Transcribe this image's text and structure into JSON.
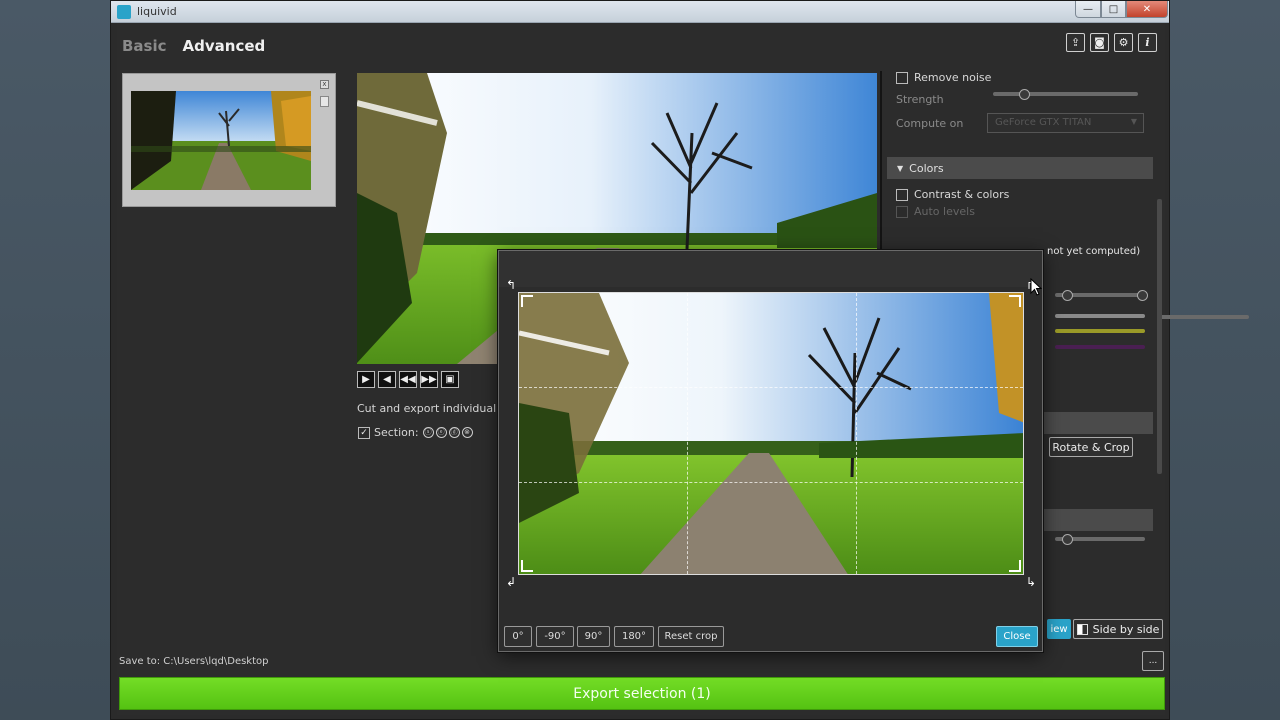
{
  "window": {
    "title": "liquivid",
    "min_glyph": "—",
    "max_glyph": "□",
    "close_glyph": "✕"
  },
  "mode_tabs": {
    "basic": "Basic",
    "advanced": "Advanced"
  },
  "top_icons": [
    {
      "name": "share-icon",
      "glyph": "⇪"
    },
    {
      "name": "camera-icon",
      "glyph": "◙"
    },
    {
      "name": "gear-icon",
      "glyph": "⚙"
    },
    {
      "name": "info-icon",
      "glyph": "i"
    }
  ],
  "thumbnail": {
    "close_glyph": "x"
  },
  "transport": [
    "▶",
    "◀",
    "◀◀",
    "▶▶",
    "▣"
  ],
  "cut_export_text": "Cut and export individual sections",
  "section": {
    "label": "Section:",
    "icons": [
      "ⓢ",
      "ⓔ",
      "ⓓ",
      "⊗"
    ],
    "checked": true
  },
  "right_panel": {
    "remove_noise": "Remove noise",
    "strength": "Strength",
    "compute_on": "Compute on",
    "compute_device": "GeForce GTX TITAN",
    "colors_header": "Colors",
    "contrast_colors": "Contrast & colors",
    "auto_levels": "Auto levels",
    "not_computed": "not yet computed)",
    "rotate_crop": "Rotate & Crop",
    "view_tab": "iew",
    "side_by_side": "Side by side"
  },
  "save_to": "Save to: C:\\Users\\lqd\\Desktop",
  "browse_label": "...",
  "export_label": "Export selection (1)",
  "crop_dialog": {
    "buttons": [
      "0°",
      "-90°",
      "90°",
      "180°",
      "Reset crop"
    ],
    "close": "Close"
  },
  "colors": {
    "accent": "#2aa3c9",
    "export_green": "#62cf1a"
  }
}
